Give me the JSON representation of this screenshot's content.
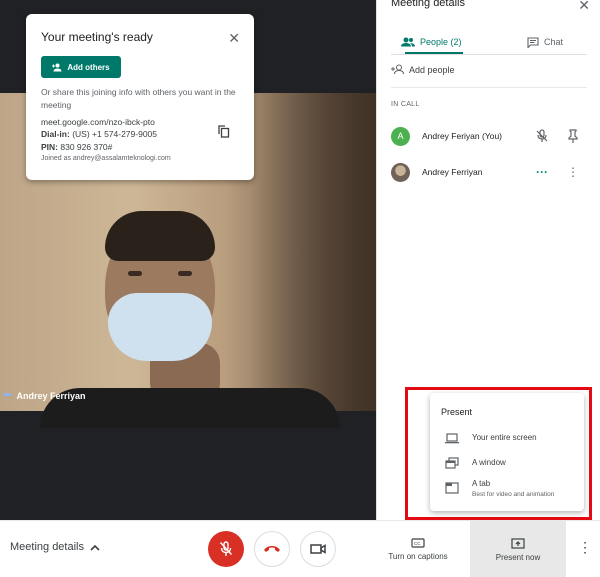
{
  "card": {
    "title": "Your meeting's ready",
    "add_others_label": "Add others",
    "description": "Or share this joining info with others you want in the meeting",
    "meeting_link": "meet.google.com/nzo-ibck-pto",
    "dial_in_label": "Dial-in:",
    "dial_in_value": "(US) +1 574-279-9005",
    "pin_label": "PIN:",
    "pin_value": "830 926 370#",
    "joined_as": "Joined as andrey@assalamteknologi.com"
  },
  "video": {
    "participant_name": "Andrey Ferriyan"
  },
  "panel": {
    "title": "Meeting details",
    "tabs": [
      {
        "label": "People (2)",
        "active": true
      },
      {
        "label": "Chat",
        "active": false
      }
    ],
    "add_people_label": "Add people",
    "section_label": "IN CALL",
    "participants": [
      {
        "initial": "A",
        "name": "Andrey Feriyan (You)"
      },
      {
        "initial": "",
        "name": "Andrey Ferriyan"
      }
    ]
  },
  "present_menu": {
    "title": "Present",
    "items": [
      {
        "label": "Your entire screen",
        "sub": "",
        "icon": "laptop-icon"
      },
      {
        "label": "A window",
        "sub": "",
        "icon": "window-icon"
      },
      {
        "label": "A tab",
        "sub": "Best for video and animation",
        "icon": "tab-icon"
      }
    ]
  },
  "bottom_bar": {
    "meeting_details_label": "Meeting details",
    "captions_label": "Turn on captions",
    "present_now_label": "Present now"
  },
  "colors": {
    "accent": "#00796b",
    "danger": "#d93025",
    "highlight_box": "#e50914"
  }
}
